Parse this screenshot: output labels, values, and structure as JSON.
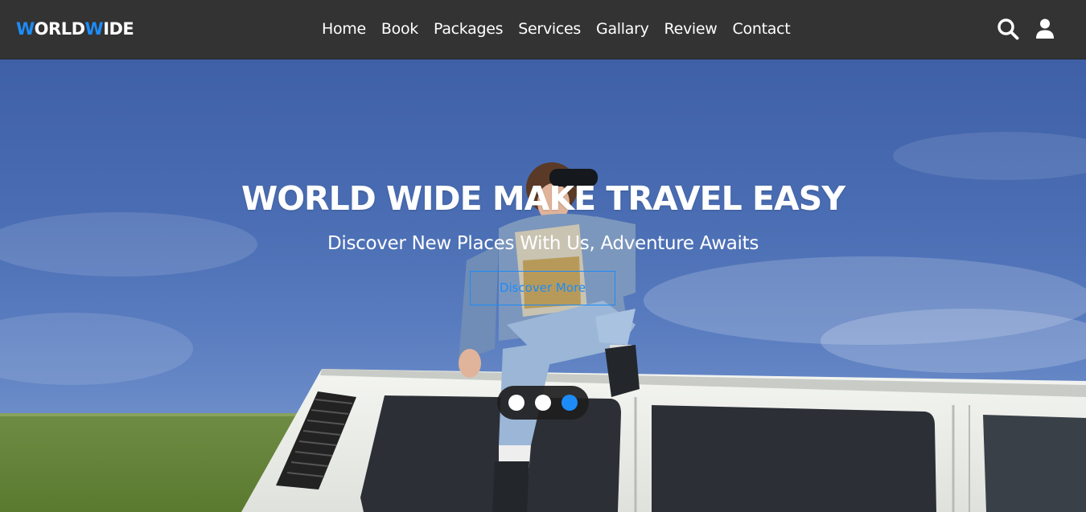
{
  "brand": {
    "logo_first_letter": "W",
    "logo_part1": "ORLD",
    "logo_middle_letter": "W",
    "logo_part2": "IDE",
    "accent_color": "#1d8cf8",
    "header_bg": "#333333"
  },
  "nav": {
    "items": [
      {
        "label": "Home"
      },
      {
        "label": "Book"
      },
      {
        "label": "Packages"
      },
      {
        "label": "Services"
      },
      {
        "label": "Gallary"
      },
      {
        "label": "Review"
      },
      {
        "label": "Contact"
      }
    ]
  },
  "header_icons": {
    "search": "search-icon",
    "user": "user-icon"
  },
  "hero": {
    "title": "WORLD WIDE MAKE TRAVEL EASY",
    "subtitle": "Discover New Places With Us, Adventure Awaits",
    "cta_label": "Discover More",
    "slider": {
      "total_slides": 3,
      "active_slide": 3
    }
  }
}
